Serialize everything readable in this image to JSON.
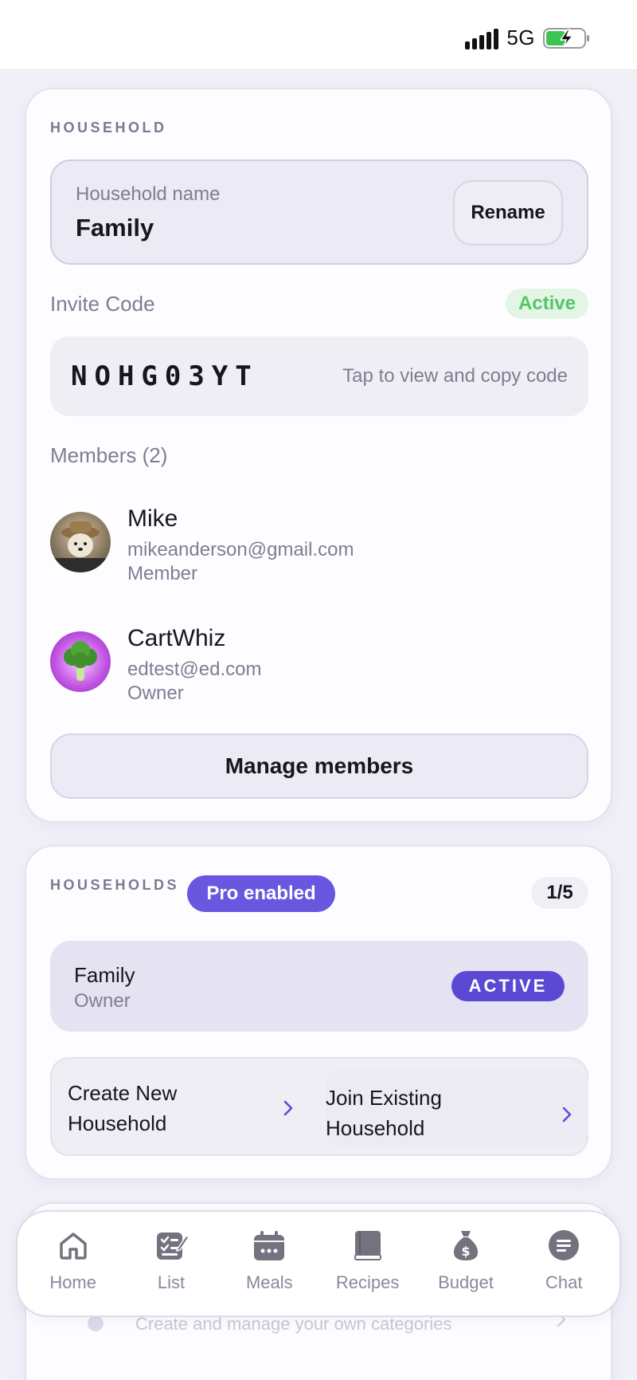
{
  "status_bar": {
    "network": "5G"
  },
  "household": {
    "section_title": "HOUSEHOLD",
    "name_label": "Household name",
    "name_value": "Family",
    "rename_label": "Rename",
    "invite_label": "Invite Code",
    "invite_status": "Active",
    "invite_code": "NOHG03YT",
    "invite_hint": "Tap to view and copy code",
    "members_label": "Members (2)",
    "members": [
      {
        "name": "Mike",
        "email": "mikeanderson@gmail.com",
        "role": "Member",
        "avatar": "dog-avatar"
      },
      {
        "name": "CartWhiz",
        "email": "edtest@ed.com",
        "role": "Owner",
        "avatar": "broccoli-avatar"
      }
    ],
    "manage_label": "Manage members"
  },
  "households": {
    "section_title": "HOUSEHOLDS",
    "pro_badge": "Pro enabled",
    "count": "1/5",
    "items": [
      {
        "name": "Family",
        "role": "Owner",
        "status": "ACTIVE"
      }
    ],
    "actions": [
      {
        "label": "Create New Household"
      },
      {
        "label": "Join Existing Household"
      }
    ]
  },
  "peek": {
    "text": "Create and manage your own categories"
  },
  "tabs": [
    {
      "label": "Home",
      "icon": "home-icon"
    },
    {
      "label": "List",
      "icon": "list-icon"
    },
    {
      "label": "Meals",
      "icon": "meals-icon"
    },
    {
      "label": "Recipes",
      "icon": "recipes-icon"
    },
    {
      "label": "Budget",
      "icon": "budget-icon"
    },
    {
      "label": "Chat",
      "icon": "chat-icon"
    }
  ],
  "colors": {
    "accent": "#6a57e0",
    "active_green": "#57c468",
    "background": "#f1f0f7"
  }
}
